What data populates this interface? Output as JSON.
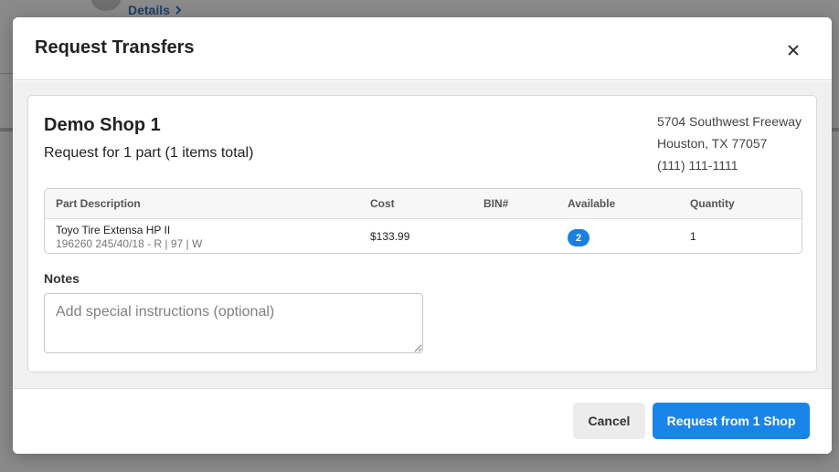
{
  "background": {
    "details_link": "Details"
  },
  "modal": {
    "title": "Request Transfers"
  },
  "shop": {
    "name": "Demo Shop 1",
    "request_summary": "Request for 1 part (1 items total)",
    "address_line1": "5704 Southwest Freeway",
    "address_line2": "Houston, TX 77057",
    "phone": "(111) 111-1111"
  },
  "table": {
    "headers": {
      "description": "Part Description",
      "cost": "Cost",
      "bin": "BIN#",
      "available": "Available",
      "quantity": "Quantity"
    },
    "rows": [
      {
        "name": "Toyo Tire Extensa HP II",
        "details": "196260 245/40/18 - R | 97 | W",
        "cost": "$133.99",
        "bin": "",
        "available": "2",
        "quantity": "1"
      }
    ]
  },
  "notes": {
    "label": "Notes",
    "placeholder": "Add special instructions (optional)",
    "value": ""
  },
  "footer": {
    "cancel_label": "Cancel",
    "submit_label": "Request from 1 Shop"
  },
  "colors": {
    "primary": "#1a85e8",
    "badge": "#1a7fe0",
    "overlay": "#7a7a7a"
  }
}
